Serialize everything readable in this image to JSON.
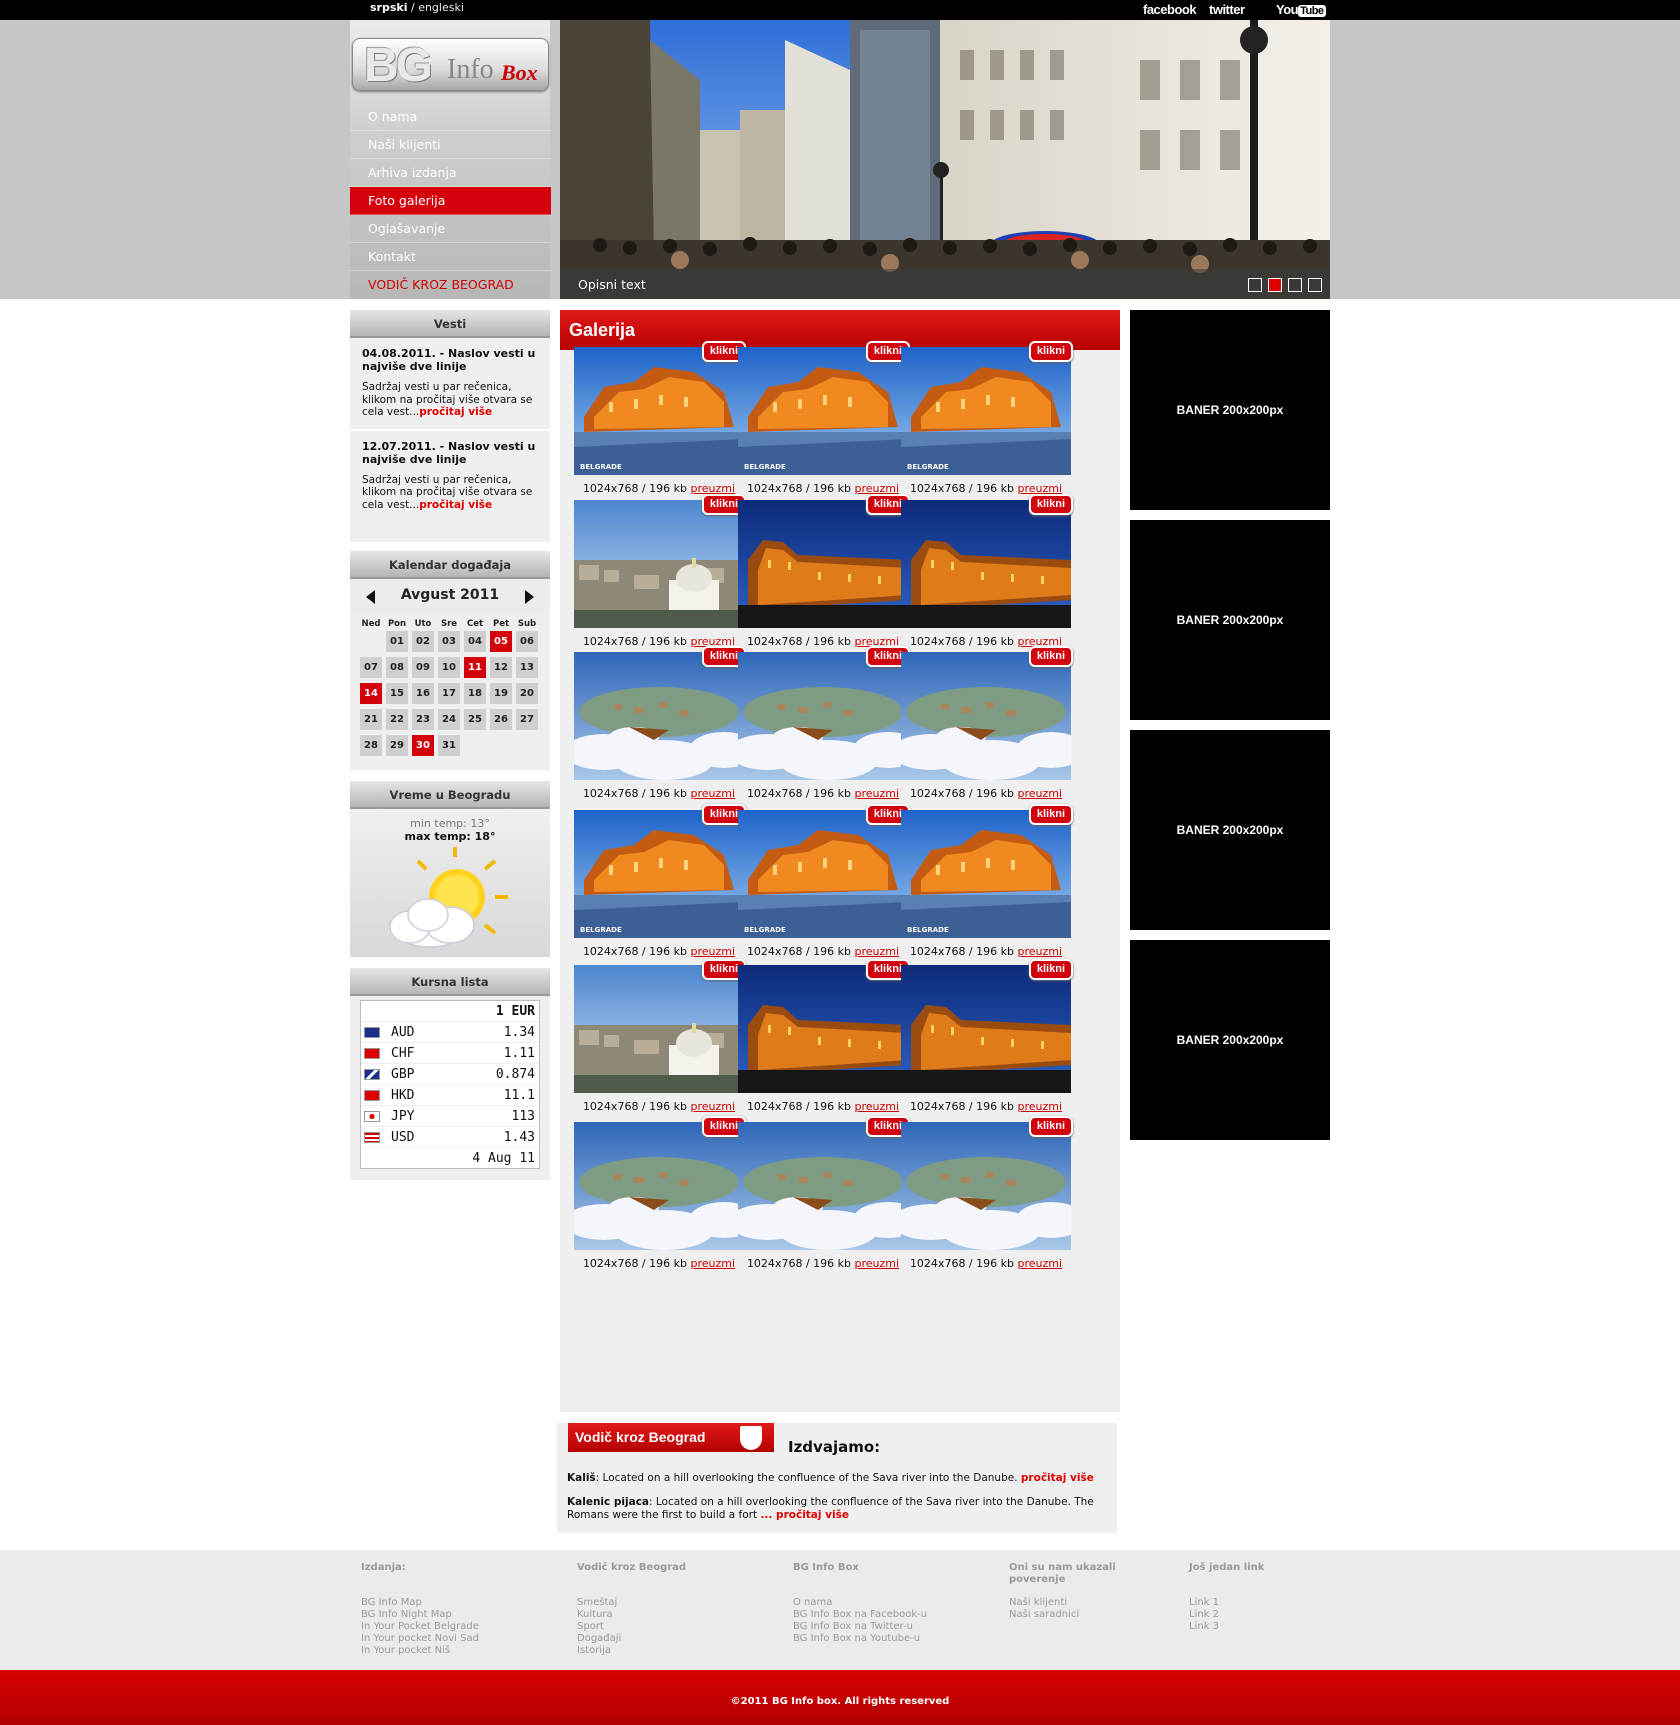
{
  "topbar": {
    "lang_active": "srpski",
    "lang_sep": " / ",
    "lang_other": "engleski",
    "social": [
      "facebook",
      "twitter",
      "YouTube"
    ]
  },
  "logo": {
    "bg": "BG",
    "info": "Info",
    "box": "Box"
  },
  "menu": [
    "O nama",
    "Naši klijenti",
    "Arhiva izdanja",
    "Foto galerija",
    "Oglašavanje",
    "Kontakt",
    "VODIČ KROZ BEOGRAD"
  ],
  "menu_active": "Foto galerija",
  "hero": {
    "caption": "Opisni text",
    "slides": 4,
    "active_slide": 2
  },
  "news": {
    "title": "Vesti",
    "items": [
      {
        "heading": "04.08.2011. - Naslov vesti u najviše dve linije",
        "body": "Sadržaj vesti u par rečenica, klikom na pročitaj više otvara se cela vest...",
        "more": "pročitaj više"
      },
      {
        "heading": "12.07.2011. - Naslov vesti u najviše dve linije",
        "body": "Sadržaj vesti u par rečenica, klikom na pročitaj više otvara se cela vest...",
        "more": "pročitaj više"
      }
    ]
  },
  "calendar": {
    "title": "Kalendar događaja",
    "month": "Avgust 2011",
    "day_names": [
      "Ned",
      "Pon",
      "Uto",
      "Sre",
      "Cet",
      "Pet",
      "Sub"
    ],
    "first_weekday": 1,
    "days": [
      "01",
      "02",
      "03",
      "04",
      "05",
      "06",
      "07",
      "08",
      "09",
      "10",
      "11",
      "12",
      "13",
      "14",
      "15",
      "16",
      "17",
      "18",
      "19",
      "20",
      "21",
      "22",
      "23",
      "24",
      "25",
      "26",
      "27",
      "28",
      "29",
      "30",
      "31"
    ],
    "highlighted": [
      "05",
      "11",
      "14",
      "30"
    ]
  },
  "weather": {
    "title": "Vreme u Beogradu",
    "min": "min temp: 13°",
    "max": "max temp: 18°",
    "icon": "partly-sunny-icon"
  },
  "rates": {
    "title": "Kursna lista",
    "base": "1 EUR",
    "rows": [
      {
        "cur": "AUD",
        "val": "1.34",
        "flag": "australia-flag-icon"
      },
      {
        "cur": "CHF",
        "val": "1.11",
        "flag": "switzerland-flag-icon"
      },
      {
        "cur": "GBP",
        "val": "0.874",
        "flag": "uk-flag-icon"
      },
      {
        "cur": "HKD",
        "val": "11.1",
        "flag": "hongkong-flag-icon"
      },
      {
        "cur": "JPY",
        "val": "113",
        "flag": "japan-flag-icon"
      },
      {
        "cur": "USD",
        "val": "1.43",
        "flag": "usa-flag-icon"
      }
    ],
    "date": "4 Aug 11"
  },
  "gallery": {
    "title": "Galerija",
    "badge": "klikni",
    "size_text": "1024x768 / 196 kb",
    "download": "preuzmi",
    "tiles": [
      "fortress-day",
      "fortress-day",
      "fortress-day",
      "cathedral",
      "fortress-night",
      "fortress-night",
      "clouds-city",
      "clouds-city",
      "clouds-city",
      "fortress-day",
      "fortress-day",
      "fortress-day",
      "cathedral",
      "fortress-night",
      "fortress-night",
      "clouds-city",
      "clouds-city",
      "clouds-city"
    ]
  },
  "guide": {
    "title": "Vodič kroz Beograd",
    "izdvajamo": "Izdvajamo:",
    "items": [
      {
        "name": "Kališ",
        "text": ": Located on a hill overlooking the confluence of the Sava river into the Danube. ",
        "more": "pročitaj više"
      },
      {
        "name": "Kalenic pijaca",
        "text": ": Located on a hill overlooking the confluence of the Sava river into the Danube. The Romans were the first to build a fort ",
        "more": "... pročitaj više"
      }
    ]
  },
  "banners": [
    "BANER 200x200px",
    "BANER 200x200px",
    "BANER 200x200px",
    "BANER 200x200px"
  ],
  "footer": {
    "cols": [
      {
        "title": "Izdanja:",
        "links": [
          "BG Info Map",
          "BG Info Night Map",
          "In Your Pocket Belgrade",
          "In Your pocket Novi Sad",
          "In Your pocket Niš"
        ]
      },
      {
        "title": "Vodič kroz Beograd",
        "links": [
          "Smeštaj",
          "Kultura",
          "Sport",
          "Događaji",
          "Istorija"
        ]
      },
      {
        "title": "BG Info Box",
        "links": [
          "O nama",
          "BG Info Box na Facebook-u",
          "BG Info Box na Twitter-u",
          "BG Info Box na Youtube-u"
        ]
      },
      {
        "title": "Oni su nam ukazali poverenje",
        "links": [
          "Naši klijenti",
          "Naši saradnici"
        ]
      },
      {
        "title": "Još jedan link",
        "links": [
          "Link 1",
          "Link 2",
          "Link 3"
        ]
      }
    ],
    "copyright": "©2011 BG Info box. All rights reserved"
  },
  "colors": {
    "accent": "#d3000b",
    "band": "#c6c6c6",
    "panel": "#efefef"
  }
}
